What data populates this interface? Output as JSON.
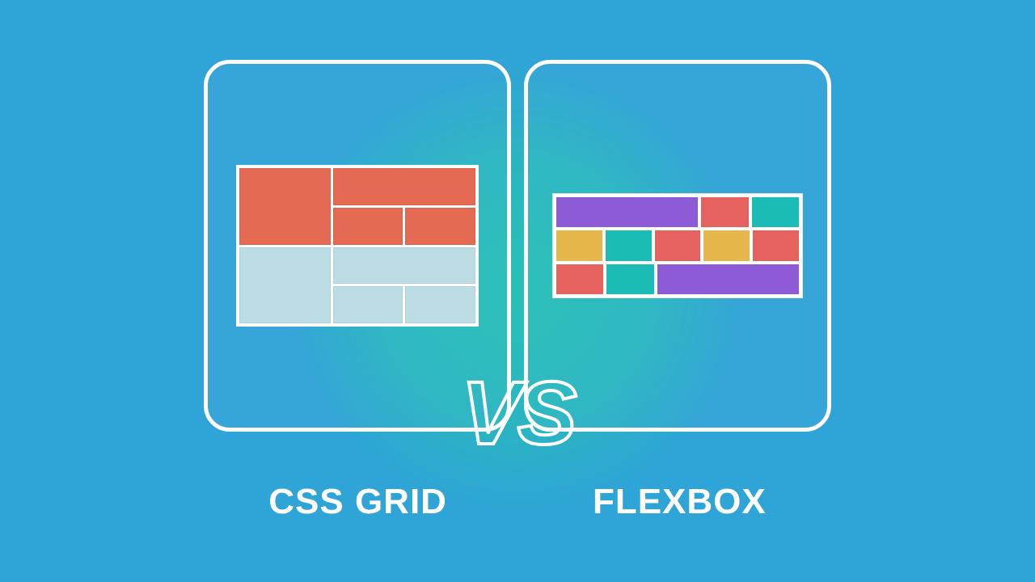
{
  "labels": {
    "left_caption": "CSS GRID",
    "right_caption": "FLEXBOX",
    "versus": "VS"
  },
  "colors": {
    "background": "#2fa4d6",
    "glow": "#26c2b3",
    "border": "#ffffff",
    "grid_orange": "#e56a54",
    "grid_pale": "#bcdde4",
    "flex_teal": "#1bbcb6",
    "flex_purple": "#8e5bd6",
    "flex_yellow": "#e6b84c",
    "flex_coral": "#e6625e"
  }
}
